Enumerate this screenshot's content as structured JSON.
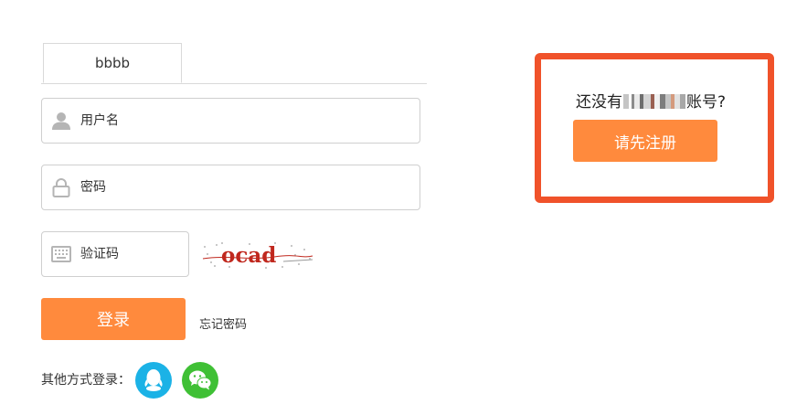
{
  "tabs": {
    "active_label": "bbbb"
  },
  "form": {
    "username_placeholder": "用户名",
    "password_placeholder": "密码",
    "captcha_placeholder": "验证码",
    "captcha_text": "ocad",
    "login_label": "登录",
    "forgot_label": "忘记密码"
  },
  "other_login": {
    "label": "其他方式登录："
  },
  "register": {
    "prompt_prefix": "还没有",
    "prompt_suffix": "账号?",
    "button_label": "请先注册"
  },
  "colors": {
    "accent": "#ff8a3d",
    "highlight_border": "#f0522a",
    "qq": "#1bb2e6",
    "wechat": "#3fc035"
  },
  "icons": {
    "username": "user-icon",
    "password": "lock-icon",
    "captcha": "keyboard-icon",
    "qq": "qq-icon",
    "wechat": "wechat-icon"
  }
}
